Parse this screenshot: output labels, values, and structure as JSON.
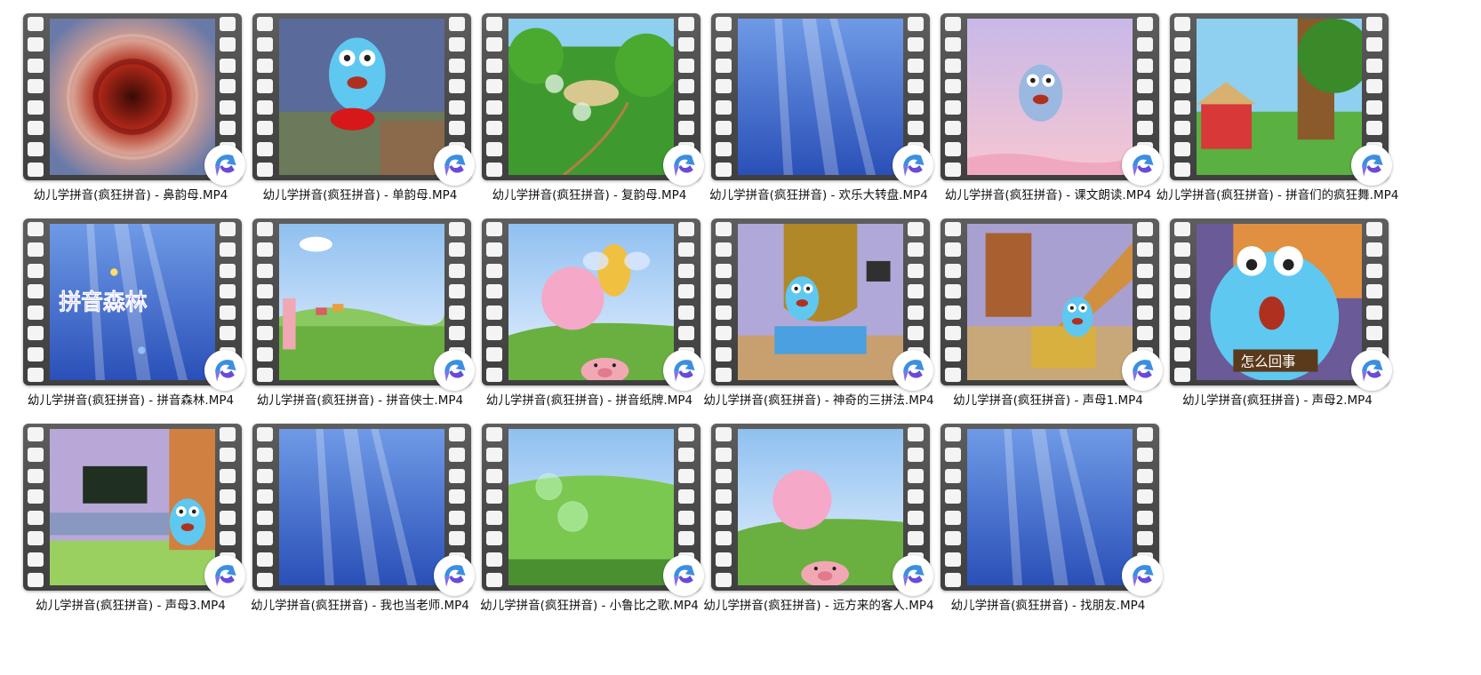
{
  "files": [
    {
      "name": "幼儿学拼音(疯狂拼音) - 鼻韵母.MP4",
      "thumb": "tunnel"
    },
    {
      "name": "幼儿学拼音(疯狂拼音) - 单韵母.MP4",
      "thumb": "character-jump"
    },
    {
      "name": "幼儿学拼音(疯狂拼音) - 复韵母.MP4",
      "thumb": "forest"
    },
    {
      "name": "幼儿学拼音(疯狂拼音) - 欢乐大转盘.MP4",
      "thumb": "underwater"
    },
    {
      "name": "幼儿学拼音(疯狂拼音) - 课文朗读.MP4",
      "thumb": "pink-sky"
    },
    {
      "name": "幼儿学拼音(疯狂拼音) - 拼音们的疯狂舞.MP4",
      "thumb": "tree-house"
    },
    {
      "name": "幼儿学拼音(疯狂拼音) - 拼音森林.MP4",
      "thumb": "title-card",
      "thumb_text": "拼音森林"
    },
    {
      "name": "幼儿学拼音(疯狂拼音) - 拼音侠士.MP4",
      "thumb": "meadow"
    },
    {
      "name": "幼儿学拼音(疯狂拼音) - 拼音纸牌.MP4",
      "thumb": "bee-bubble"
    },
    {
      "name": "幼儿学拼音(疯狂拼音) - 神奇的三拼法.MP4",
      "thumb": "room"
    },
    {
      "name": "幼儿学拼音(疯狂拼音) - 声母1.MP4",
      "thumb": "stairs"
    },
    {
      "name": "幼儿学拼音(疯狂拼音) - 声母2.MP4",
      "thumb": "closeup",
      "thumb_text": "怎么回事"
    },
    {
      "name": "幼儿学拼音(疯狂拼音) - 声母3.MP4",
      "thumb": "classroom"
    },
    {
      "name": "幼儿学拼音(疯狂拼音) - 我也当老师.MP4",
      "thumb": "underwater"
    },
    {
      "name": "幼儿学拼音(疯狂拼音) - 小鲁比之歌.MP4",
      "thumb": "bubbles-field"
    },
    {
      "name": "幼儿学拼音(疯狂拼音) - 远方来的客人.MP4",
      "thumb": "bubble-pig"
    },
    {
      "name": "幼儿学拼音(疯狂拼音) - 找朋友.MP4",
      "thumb": "underwater"
    }
  ],
  "badge_icon": "video-player-icon",
  "colors": {
    "film": "#4a4a4a",
    "badge_blue": "#3b8fe0",
    "badge_purple": "#6a4ad8"
  }
}
